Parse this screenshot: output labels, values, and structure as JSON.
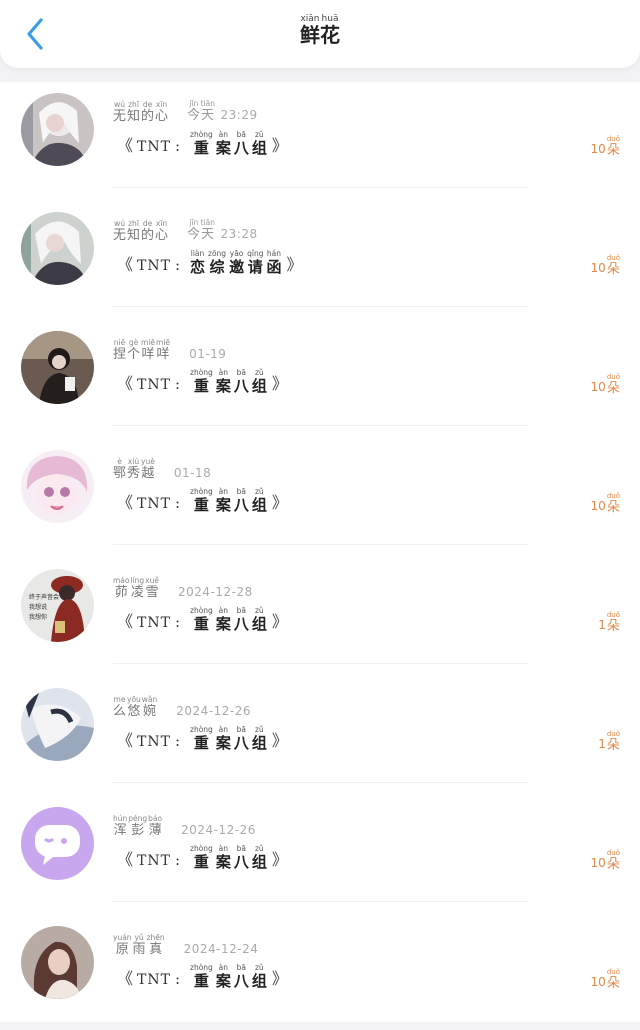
{
  "header": {
    "title": [
      {
        "char": "鲜",
        "pinyin": "xiān"
      },
      {
        "char": "花",
        "pinyin": "huā"
      }
    ]
  },
  "colors": {
    "accent_back": "#3a9ee4",
    "count_orange": "#e08a4a"
  },
  "icons": {
    "back": "chevron-left-icon"
  },
  "rows": [
    {
      "nickname": [
        {
          "char": "无",
          "pinyin": "wú"
        },
        {
          "char": "知",
          "pinyin": "zhī"
        },
        {
          "char": "的",
          "pinyin": "de"
        },
        {
          "char": "心",
          "pinyin": "xīn"
        }
      ],
      "time_word": [
        {
          "char": "今",
          "pinyin": "jīn"
        },
        {
          "char": "天",
          "pinyin": "tiān"
        }
      ],
      "time": "23:29",
      "bracket_open": "《",
      "prefix": "TNT",
      "colon": ":",
      "gift": [
        {
          "char": "重",
          "pinyin": "zhòng"
        },
        {
          "char": "案",
          "pinyin": "àn"
        },
        {
          "char": "八",
          "pinyin": "bā"
        },
        {
          "char": "组",
          "pinyin": "zǔ"
        }
      ],
      "bracket_close": "》",
      "count": "10",
      "unit": {
        "char": "朵",
        "pinyin": "duǒ"
      }
    },
    {
      "nickname": [
        {
          "char": "无",
          "pinyin": "wú"
        },
        {
          "char": "知",
          "pinyin": "zhī"
        },
        {
          "char": "的",
          "pinyin": "de"
        },
        {
          "char": "心",
          "pinyin": "xīn"
        }
      ],
      "time_word": [
        {
          "char": "今",
          "pinyin": "jīn"
        },
        {
          "char": "天",
          "pinyin": "tiān"
        }
      ],
      "time": "23:28",
      "bracket_open": "《",
      "prefix": "TNT",
      "colon": ":",
      "gift": [
        {
          "char": "恋",
          "pinyin": "liàn"
        },
        {
          "char": "综",
          "pinyin": "zōng"
        },
        {
          "char": "邀",
          "pinyin": "yāo"
        },
        {
          "char": "请",
          "pinyin": "qǐng"
        },
        {
          "char": "函",
          "pinyin": "hán"
        }
      ],
      "bracket_close": "》",
      "count": "10",
      "unit": {
        "char": "朵",
        "pinyin": "duǒ"
      }
    },
    {
      "nickname": [
        {
          "char": "捏",
          "pinyin": "niē"
        },
        {
          "char": "个",
          "pinyin": "gè"
        },
        {
          "char": "咩",
          "pinyin": "miē"
        },
        {
          "char": "咩",
          "pinyin": "miē"
        }
      ],
      "time_word": [],
      "time": "01-19",
      "bracket_open": "《",
      "prefix": "TNT",
      "colon": ":",
      "gift": [
        {
          "char": "重",
          "pinyin": "zhòng"
        },
        {
          "char": "案",
          "pinyin": "àn"
        },
        {
          "char": "八",
          "pinyin": "bā"
        },
        {
          "char": "组",
          "pinyin": "zǔ"
        }
      ],
      "bracket_close": "》",
      "count": "10",
      "unit": {
        "char": "朵",
        "pinyin": "duǒ"
      }
    },
    {
      "nickname": [
        {
          "char": "鄂",
          "pinyin": "è"
        },
        {
          "char": "秀",
          "pinyin": "xiù"
        },
        {
          "char": "越",
          "pinyin": "yuè"
        }
      ],
      "time_word": [],
      "time": "01-18",
      "bracket_open": "《",
      "prefix": "TNT",
      "colon": ":",
      "gift": [
        {
          "char": "重",
          "pinyin": "zhòng"
        },
        {
          "char": "案",
          "pinyin": "àn"
        },
        {
          "char": "八",
          "pinyin": "bā"
        },
        {
          "char": "组",
          "pinyin": "zǔ"
        }
      ],
      "bracket_close": "》",
      "count": "10",
      "unit": {
        "char": "朵",
        "pinyin": "duǒ"
      }
    },
    {
      "nickname": [
        {
          "char": "茆",
          "pinyin": "máo"
        },
        {
          "char": "凌",
          "pinyin": "líng"
        },
        {
          "char": "雪",
          "pinyin": "xuě"
        }
      ],
      "time_word": [],
      "time": "2024-12-28",
      "bracket_open": "《",
      "prefix": "TNT",
      "colon": ":",
      "gift": [
        {
          "char": "重",
          "pinyin": "zhòng"
        },
        {
          "char": "案",
          "pinyin": "àn"
        },
        {
          "char": "八",
          "pinyin": "bā"
        },
        {
          "char": "组",
          "pinyin": "zǔ"
        }
      ],
      "bracket_close": "》",
      "count": "1",
      "unit": {
        "char": "朵",
        "pinyin": "duǒ"
      }
    },
    {
      "nickname": [
        {
          "char": "么",
          "pinyin": "me"
        },
        {
          "char": "悠",
          "pinyin": "yōu"
        },
        {
          "char": "婉",
          "pinyin": "wǎn"
        }
      ],
      "time_word": [],
      "time": "2024-12-26",
      "bracket_open": "《",
      "prefix": "TNT",
      "colon": ":",
      "gift": [
        {
          "char": "重",
          "pinyin": "zhòng"
        },
        {
          "char": "案",
          "pinyin": "àn"
        },
        {
          "char": "八",
          "pinyin": "bā"
        },
        {
          "char": "组",
          "pinyin": "zǔ"
        }
      ],
      "bracket_close": "》",
      "count": "1",
      "unit": {
        "char": "朵",
        "pinyin": "duǒ"
      }
    },
    {
      "nickname": [
        {
          "char": "浑",
          "pinyin": "hún"
        },
        {
          "char": "彭",
          "pinyin": "péng"
        },
        {
          "char": "薄",
          "pinyin": "báo"
        }
      ],
      "time_word": [],
      "time": "2024-12-26",
      "bracket_open": "《",
      "prefix": "TNT",
      "colon": ":",
      "gift": [
        {
          "char": "重",
          "pinyin": "zhòng"
        },
        {
          "char": "案",
          "pinyin": "àn"
        },
        {
          "char": "八",
          "pinyin": "bā"
        },
        {
          "char": "组",
          "pinyin": "zǔ"
        }
      ],
      "bracket_close": "》",
      "count": "10",
      "unit": {
        "char": "朵",
        "pinyin": "duǒ"
      }
    },
    {
      "nickname": [
        {
          "char": "原",
          "pinyin": "yuán"
        },
        {
          "char": "雨",
          "pinyin": "yǔ"
        },
        {
          "char": "真",
          "pinyin": "zhēn"
        }
      ],
      "time_word": [],
      "time": "2024-12-24",
      "bracket_open": "《",
      "prefix": "TNT",
      "colon": ":",
      "gift": [
        {
          "char": "重",
          "pinyin": "zhòng"
        },
        {
          "char": "案",
          "pinyin": "àn"
        },
        {
          "char": "八",
          "pinyin": "bā"
        },
        {
          "char": "组",
          "pinyin": "zǔ"
        }
      ],
      "bracket_close": "》",
      "count": "10",
      "unit": {
        "char": "朵",
        "pinyin": "duǒ"
      }
    }
  ],
  "avatar5_text": [
    "终于声音会",
    "我想说",
    "我想你"
  ]
}
